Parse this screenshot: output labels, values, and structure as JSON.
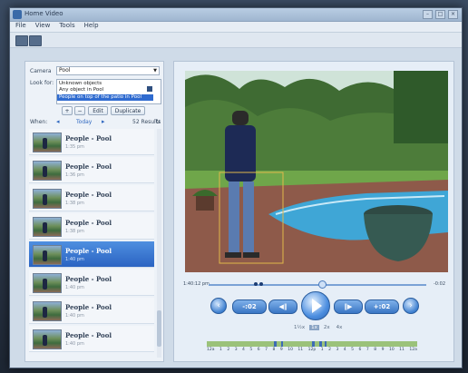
{
  "window": {
    "title": "Home Video"
  },
  "menu": [
    "File",
    "View",
    "Tools",
    "Help"
  ],
  "left": {
    "camera_label": "Camera",
    "camera_value": "Pool",
    "lookfor_label": "Look for:",
    "lookfor_options": [
      "Unknown objects",
      "Any object in Pool",
      "People on top of the patio in Pool"
    ],
    "lookfor_selected_index": 2,
    "add_label": "+",
    "remove_label": "−",
    "edit_label": "Edit",
    "duplicate_label": "Duplicate",
    "when_label": "When:",
    "when_value": "Today",
    "results_label": "52 Results",
    "items": [
      {
        "title": "People - Pool",
        "time": "1:35 pm"
      },
      {
        "title": "People - Pool",
        "time": "1:36 pm"
      },
      {
        "title": "People - Pool",
        "time": "1:38 pm"
      },
      {
        "title": "People - Pool",
        "time": "1:38 pm"
      },
      {
        "title": "People - Pool",
        "time": "1:40 pm"
      },
      {
        "title": "People - Pool",
        "time": "1:40 pm"
      },
      {
        "title": "People - Pool",
        "time": "1:40 pm"
      },
      {
        "title": "People - Pool",
        "time": "1:40 pm"
      }
    ],
    "selected_index": 4
  },
  "player": {
    "current_time": "1:40:12 pm",
    "end_time": "-0:02",
    "progress": 0.52,
    "back_label": "-:02",
    "forward_label": "+:02",
    "speeds": [
      "1½x",
      "1x",
      "2x",
      "4x"
    ],
    "active_speed_index": 1,
    "timeline_labels": [
      "12a",
      "1",
      "2",
      "3",
      "4",
      "5",
      "6",
      "7",
      "8",
      "9",
      "10",
      "11",
      "12p",
      "1",
      "2",
      "3",
      "4",
      "5",
      "6",
      "7",
      "8",
      "9",
      "10",
      "11",
      "12a"
    ]
  }
}
